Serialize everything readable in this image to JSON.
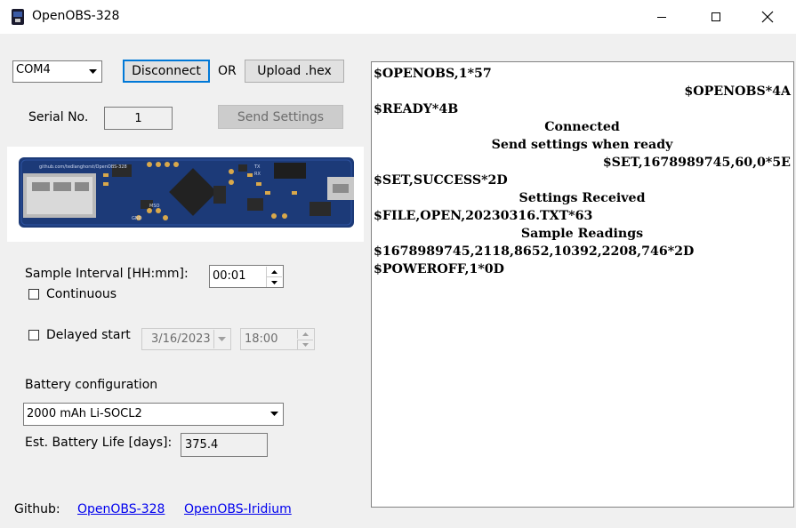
{
  "window": {
    "title": "OpenOBS-328"
  },
  "connection": {
    "port_value": "COM4",
    "disconnect_label": "Disconnect",
    "or_label": "OR",
    "upload_label": "Upload .hex"
  },
  "serial": {
    "label": "Serial No.",
    "value": "1",
    "send_label": "Send Settings"
  },
  "board_image": {
    "silk_url": "github.com/tedlanghorst/OpenOBS-328",
    "label_gnd": "GND",
    "label_tx": "TX",
    "label_rx": "RX",
    "label_mso": "MSO"
  },
  "sample": {
    "label": "Sample Interval [HH:mm]:",
    "value": "00:01",
    "continuous_label": "Continuous"
  },
  "delayed": {
    "label": "Delayed start",
    "date": "3/16/2023",
    "time": "18:00"
  },
  "battery": {
    "label": "Battery configuration",
    "value": "2000 mAh Li-SOCL2",
    "life_label": "Est. Battery Life [days]:",
    "life_value": "375.4"
  },
  "footer": {
    "github_label": "Github:",
    "link1": "OpenOBS-328",
    "link2": "OpenOBS-Iridium"
  },
  "console": {
    "lines": [
      {
        "text": "$OPENOBS,1*57",
        "align": "l"
      },
      {
        "text": "$OPENOBS*4A",
        "align": "r"
      },
      {
        "text": "$READY*4B",
        "align": "l"
      },
      {
        "text": "Connected",
        "align": "c"
      },
      {
        "text": "Send settings when ready",
        "align": "c"
      },
      {
        "text": "$SET,1678989745,60,0*5E",
        "align": "r"
      },
      {
        "text": "$SET,SUCCESS*2D",
        "align": "l"
      },
      {
        "text": "Settings Received",
        "align": "c"
      },
      {
        "text": "$FILE,OPEN,20230316.TXT*63",
        "align": "l"
      },
      {
        "text": "Sample Readings",
        "align": "c"
      },
      {
        "text": "$1678989745,2118,8652,10392,2208,746*2D",
        "align": "l"
      },
      {
        "text": "$POWEROFF,1*0D",
        "align": "l"
      }
    ]
  },
  "colors": {
    "board_blue": "#1c3a78",
    "link": "#0000ee",
    "background": "#f0f0f0"
  }
}
